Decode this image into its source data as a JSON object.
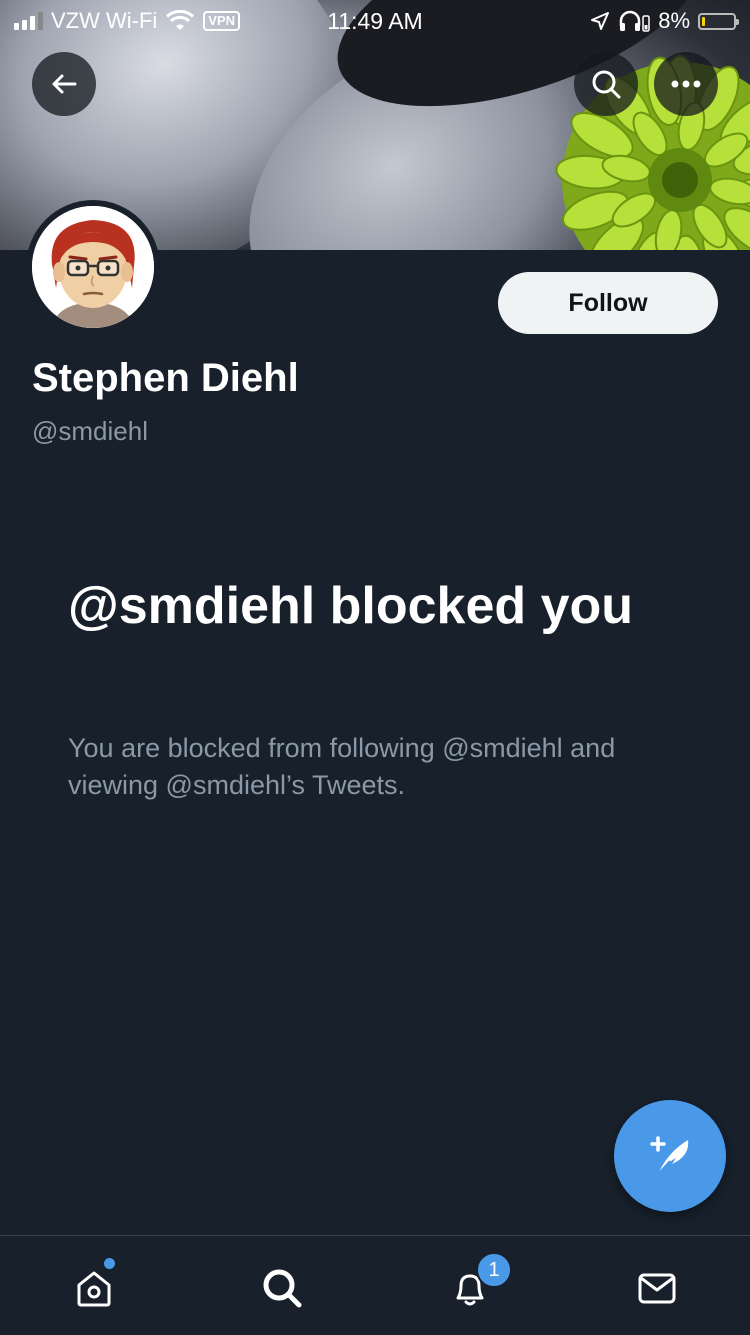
{
  "status_bar": {
    "carrier": "VZW Wi-Fi",
    "vpn": "VPN",
    "time": "11:49 AM",
    "battery_percent": "8%",
    "battery_level": 0.08,
    "signal_bars": 3
  },
  "header": {
    "back_icon": "arrow-left-icon",
    "search_icon": "search-icon",
    "more_icon": "more-horizontal-icon"
  },
  "profile": {
    "display_name": "Stephen Diehl",
    "handle": "@smdiehl",
    "follow_label": "Follow"
  },
  "blocked": {
    "title": "@smdiehl blocked you",
    "description": "You are blocked from following @smdiehl and viewing @smdiehl’s Tweets."
  },
  "tabbar": {
    "home_icon": "home-icon",
    "search_icon": "search-icon",
    "notifications_icon": "bell-icon",
    "notifications_badge": "1",
    "messages_icon": "mail-icon"
  },
  "colors": {
    "background": "#17202b",
    "accent": "#4a99e9",
    "secondary_text": "#8b98a5"
  }
}
